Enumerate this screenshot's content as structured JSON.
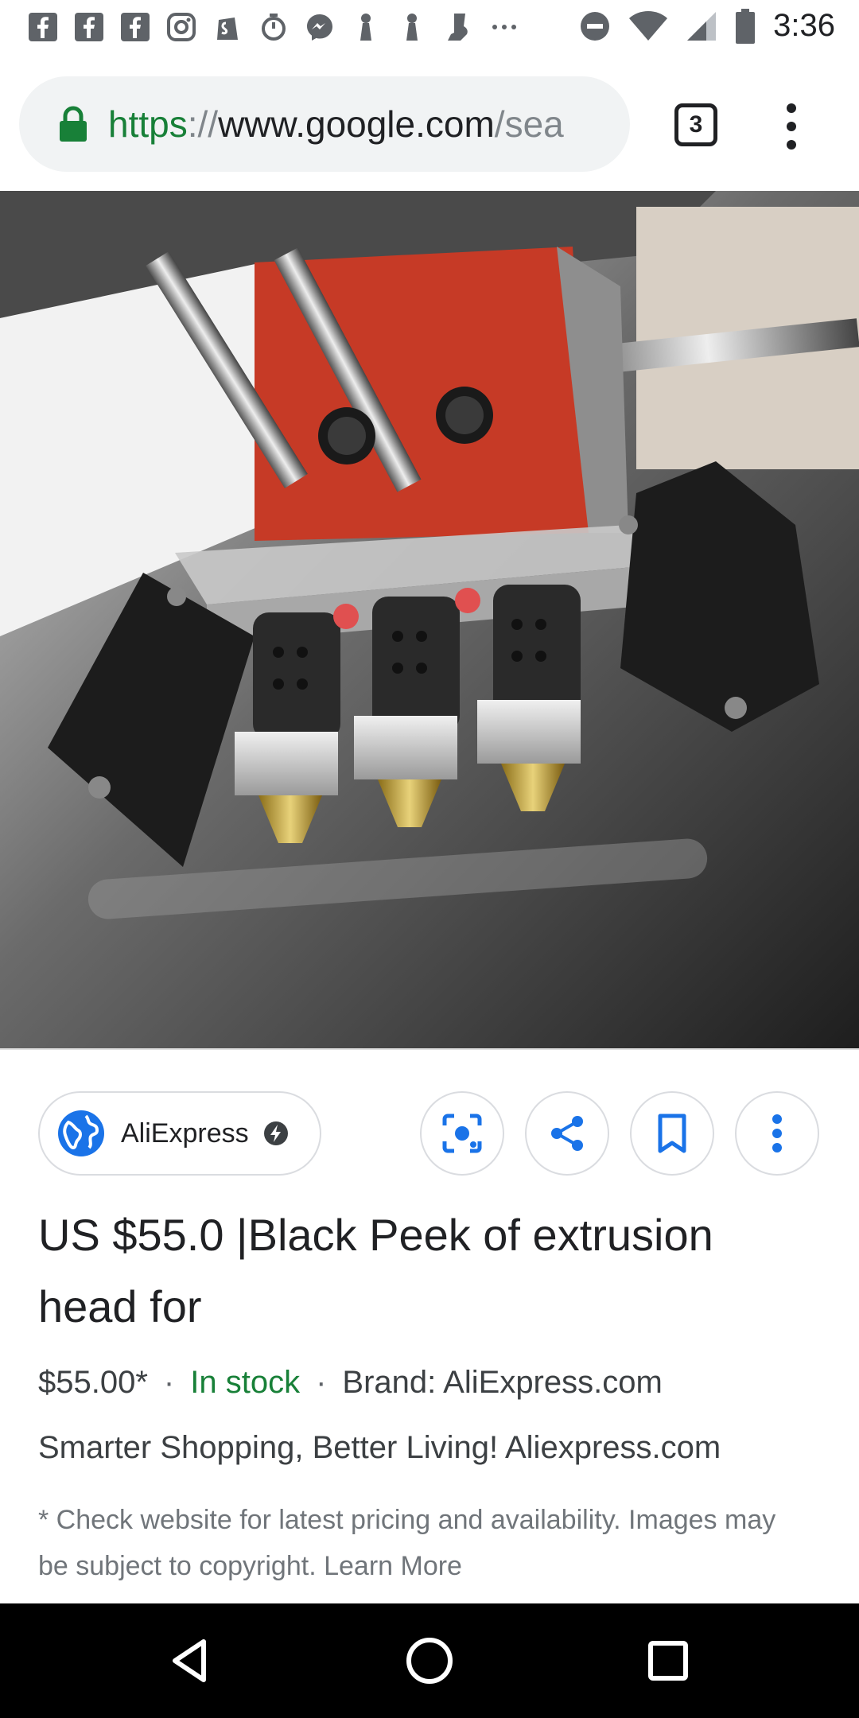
{
  "status_bar": {
    "time": "3:36",
    "left_icons": [
      "facebook-icon",
      "facebook-icon",
      "facebook-icon",
      "instagram-icon",
      "shopify-icon",
      "stopwatch-icon",
      "messenger-icon",
      "figure-icon",
      "figure-icon",
      "boot-icon",
      "more-dots-icon"
    ],
    "right_icons": [
      "do-not-disturb-icon",
      "wifi-icon",
      "signal-icon",
      "battery-icon"
    ]
  },
  "browser": {
    "url_scheme": "https",
    "url_separator": "://",
    "url_host": "www.google.com",
    "url_path": "/sea",
    "tab_count": "3"
  },
  "result": {
    "source_name": "AliExpress",
    "title": "US $55.0 |Black Peek of extrusion head for",
    "price": "$55.00*",
    "separator": "·",
    "stock": "In stock",
    "brand": "Brand: AliExpress.com",
    "description": "Smarter Shopping, Better Living! Aliexpress.com",
    "note": "* Check website for latest pricing and availability. Images may be subject to copyright. Learn More"
  },
  "colors": {
    "accent": "#1a73e8",
    "secure_green": "#188038",
    "text": "#202124",
    "muted": "#70757a",
    "hero_red": "#c63a26"
  }
}
